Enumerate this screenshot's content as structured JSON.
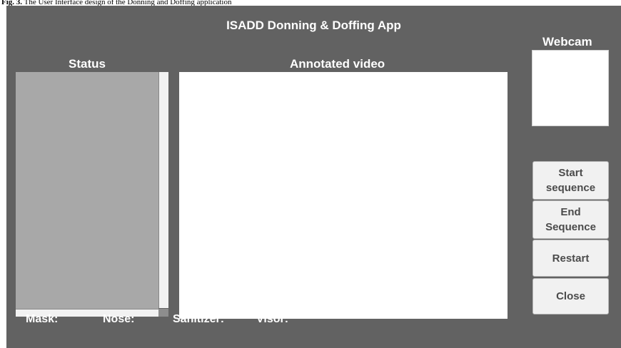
{
  "caption": {
    "figure_label": "Fig. 3.",
    "text": "The User Interface design of the Donning and Doffing application"
  },
  "window": {
    "title": "ISADD Donning & Doffing App"
  },
  "panels": {
    "status_label": "Status",
    "video_label": "Annotated video",
    "webcam_label": "Webcam"
  },
  "buttons": {
    "start": "Start\nsequence",
    "end": "End\nSequence",
    "restart": "Restart",
    "close": "Close"
  },
  "indicators": [
    {
      "label": "Mask:"
    },
    {
      "label": "Nose:"
    },
    {
      "label": "Sanitizer:"
    },
    {
      "label": "Visor:"
    }
  ],
  "colors": {
    "window_bg": "#626262",
    "status_bg": "#a8a8a8",
    "button_bg": "#f1f1f1"
  }
}
